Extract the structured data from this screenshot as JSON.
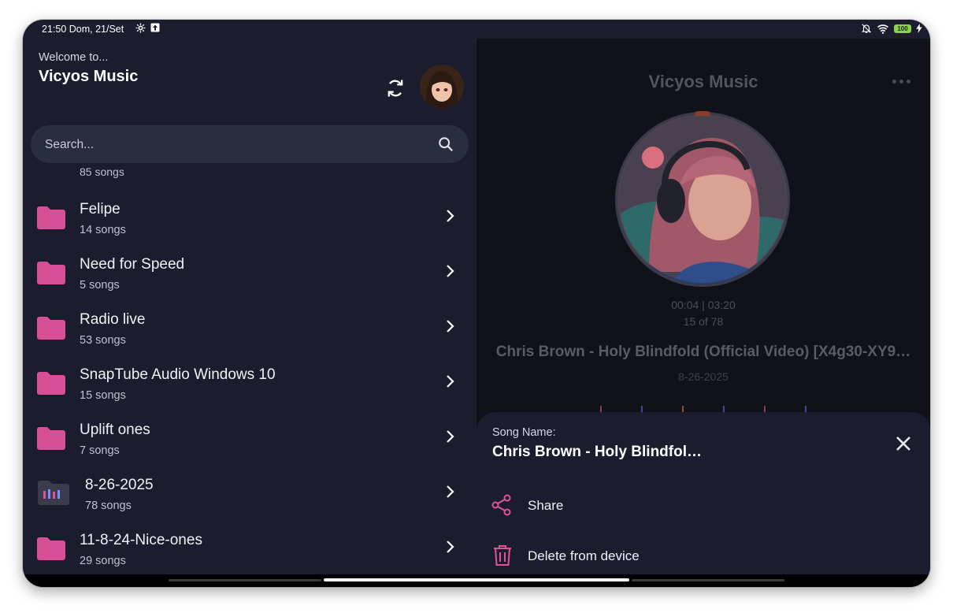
{
  "status": {
    "time": "21:50 Dom, 21/Set",
    "battery": "100"
  },
  "header": {
    "welcome": "Welcome to...",
    "title": "Vicyos Music"
  },
  "search": {
    "placeholder": "Search..."
  },
  "partial_item": {
    "count": "85 songs"
  },
  "folders": [
    {
      "name": "Felipe",
      "count": "14 songs"
    },
    {
      "name": "Need for Speed",
      "count": "5 songs"
    },
    {
      "name": "Radio live",
      "count": "53 songs"
    },
    {
      "name": "SnapTube Audio Windows 10",
      "count": "15 songs"
    },
    {
      "name": "Uplift ones",
      "count": "7 songs"
    },
    {
      "name": "8-26-2025",
      "count": "78 songs"
    },
    {
      "name": "11-8-24-Nice-ones",
      "count": "29 songs"
    }
  ],
  "player": {
    "title": "Vicyos Music",
    "time": "00:04 | 03:20",
    "track": "15 of 78",
    "song": "Chris Brown - Holy Blindfold (Official Video) [X4g30-XY9…",
    "date": "8-26-2025"
  },
  "sheet": {
    "label": "Song Name:",
    "name": "Chris Brown - Holy Blindfol…",
    "share": "Share",
    "delete": "Delete from device"
  },
  "colors": {
    "accent": "#e0529c",
    "background": "#1b1d2e",
    "player_background": "#111219"
  }
}
